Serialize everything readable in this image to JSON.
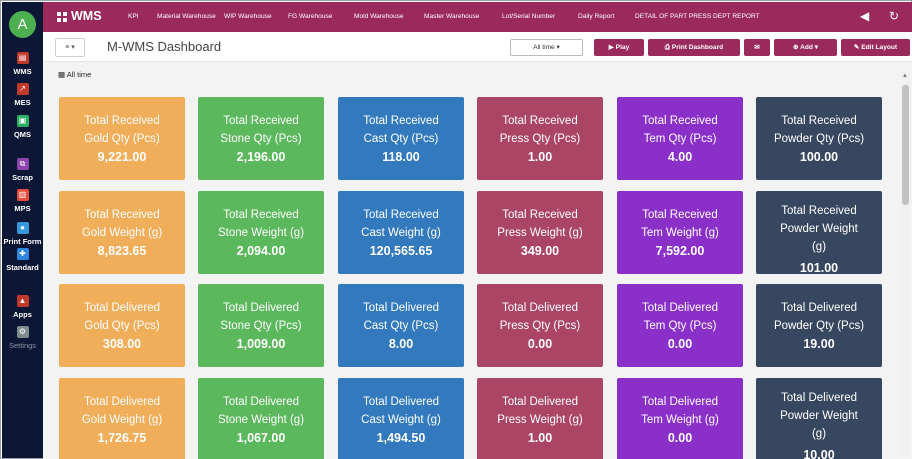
{
  "sidebar": {
    "avatar_initial": "A",
    "items": [
      {
        "label": "WMS",
        "icon": "warehouse-icon",
        "color": "#c0392b",
        "glyph": "▤"
      },
      {
        "label": "MES",
        "icon": "factory-icon",
        "color": "#c0392b",
        "glyph": "↗"
      },
      {
        "label": "QMS",
        "icon": "quality-icon",
        "color": "#27ae60",
        "glyph": "▣"
      },
      {
        "label": "Scrap",
        "icon": "scrap-icon",
        "color": "#8e44ad",
        "glyph": "⧉"
      },
      {
        "label": "MPS",
        "icon": "schedule-icon",
        "color": "#e74c3c",
        "glyph": "▥"
      },
      {
        "label": "Print Form",
        "icon": "print-icon",
        "color": "#3498db",
        "glyph": "●"
      },
      {
        "label": "Standard",
        "icon": "standard-icon",
        "color": "#2e86de",
        "glyph": "✚"
      },
      {
        "label": "Apps",
        "icon": "apps-icon",
        "color": "#c0392b",
        "glyph": "▲"
      },
      {
        "label": "Settings",
        "icon": "settings-icon",
        "color": "#7f8c8d",
        "glyph": "⚙"
      }
    ]
  },
  "topbar": {
    "brand": "WMS",
    "nav": [
      "KPI",
      "Material Warehouse",
      "WIP Warehouse",
      "FG Warehouse",
      "Mold Warehouse",
      "Master Warehouse",
      "Lot/Serial Number",
      "Daily Report",
      "DETAIL OF PART PRESS DEPT REPORT"
    ],
    "accent": "#9a2a5c"
  },
  "toolbar": {
    "filter_label": "≡ ▾",
    "title": "M-WMS Dashboard",
    "time_filter": "All time ▾",
    "play": "▶ Play",
    "print": "⎙ Print Dashboard",
    "mail": "✉",
    "add": "⊕ Add ▾",
    "edit": "✎ Edit Layout"
  },
  "range_label": "All time",
  "cards": [
    {
      "line1": "Total Received",
      "line2": "Gold Qty (Pcs)",
      "value": "9,221.00",
      "color": "gold"
    },
    {
      "line1": "Total Received",
      "line2": "Stone Qty (Pcs)",
      "value": "2,196.00",
      "color": "stone"
    },
    {
      "line1": "Total Received",
      "line2": "Cast Qty (Pcs)",
      "value": "118.00",
      "color": "cast"
    },
    {
      "line1": "Total Received",
      "line2": "Press Qty (Pcs)",
      "value": "1.00",
      "color": "press"
    },
    {
      "line1": "Total Received",
      "line2": "Tem Qty (Pcs)",
      "value": "4.00",
      "color": "tem"
    },
    {
      "line1": "Total Received",
      "line2": "Powder Qty (Pcs)",
      "value": "100.00",
      "color": "powder"
    },
    {
      "line1": "Total Received",
      "line2": "Gold Weight (g)",
      "value": "8,823.65",
      "color": "gold"
    },
    {
      "line1": "Total Received",
      "line2": "Stone Weight (g)",
      "value": "2,094.00",
      "color": "stone"
    },
    {
      "line1": "Total Received",
      "line2": "Cast Weight (g)",
      "value": "120,565.65",
      "color": "cast"
    },
    {
      "line1": "Total Received",
      "line2": "Press Weight (g)",
      "value": "349.00",
      "color": "press"
    },
    {
      "line1": "Total Received",
      "line2": "Tem Weight (g)",
      "value": "7,592.00",
      "color": "tem"
    },
    {
      "line1": "Total Received",
      "line2": "Powder Weight",
      "line3": "(g)",
      "value": "101.00",
      "color": "powder"
    },
    {
      "line1": "Total Delivered",
      "line2": "Gold Qty (Pcs)",
      "value": "308.00",
      "color": "gold"
    },
    {
      "line1": "Total Delivered",
      "line2": "Stone Qty (Pcs)",
      "value": "1,009.00",
      "color": "stone"
    },
    {
      "line1": "Total Delivered",
      "line2": "Cast Qty (Pcs)",
      "value": "8.00",
      "color": "cast"
    },
    {
      "line1": "Total Delivered",
      "line2": "Press Qty (Pcs)",
      "value": "0.00",
      "color": "press"
    },
    {
      "line1": "Total Delivered",
      "line2": "Tem Qty (Pcs)",
      "value": "0.00",
      "color": "tem"
    },
    {
      "line1": "Total Delivered",
      "line2": "Powder Qty (Pcs)",
      "value": "19.00",
      "color": "powder"
    },
    {
      "line1": "Total Delivered",
      "line2": "Gold Weight (g)",
      "value": "1,726.75",
      "color": "gold"
    },
    {
      "line1": "Total Delivered",
      "line2": "Stone Weight (g)",
      "value": "1,067.00",
      "color": "stone"
    },
    {
      "line1": "Total Delivered",
      "line2": "Cast Weight (g)",
      "value": "1,494.50",
      "color": "cast"
    },
    {
      "line1": "Total Delivered",
      "line2": "Press Weight (g)",
      "value": "1.00",
      "color": "press"
    },
    {
      "line1": "Total Delivered",
      "line2": "Tem Weight (g)",
      "value": "0.00",
      "color": "tem"
    },
    {
      "line1": "Total Delivered",
      "line2": "Powder Weight",
      "line3": "(g)",
      "value": "10.00",
      "color": "powder"
    }
  ]
}
